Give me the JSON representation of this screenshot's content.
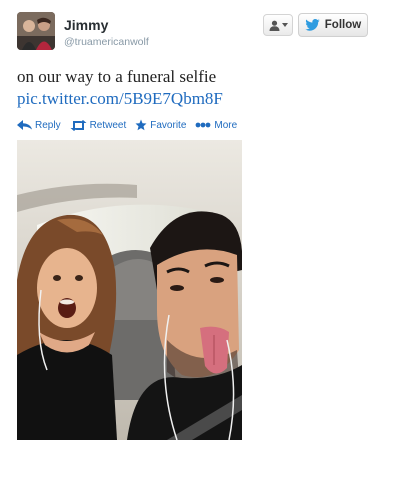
{
  "user": {
    "display_name": "Jimmy",
    "screen_name": "@truamericanwolf",
    "avatar_icon": "user-avatar-icon"
  },
  "header_actions": {
    "user_menu_icon": "person-dropdown-icon",
    "follow_label": "Follow",
    "follow_icon": "twitter-bird-icon"
  },
  "tweet": {
    "text": "on our way to a funeral selfie",
    "link": "pic.twitter.com/5B9E7Qbm8F"
  },
  "actions": [
    {
      "label": "Reply",
      "icon": "reply-arrow-icon"
    },
    {
      "label": "Retweet",
      "icon": "retweet-icon"
    },
    {
      "label": "Favorite",
      "icon": "star-icon"
    },
    {
      "label": "More",
      "icon": "dots-icon"
    }
  ],
  "colors": {
    "link": "#1f6bbf",
    "name": "#292f33",
    "handle": "#8899a6",
    "twitter_blue": "#2f9ce0"
  }
}
